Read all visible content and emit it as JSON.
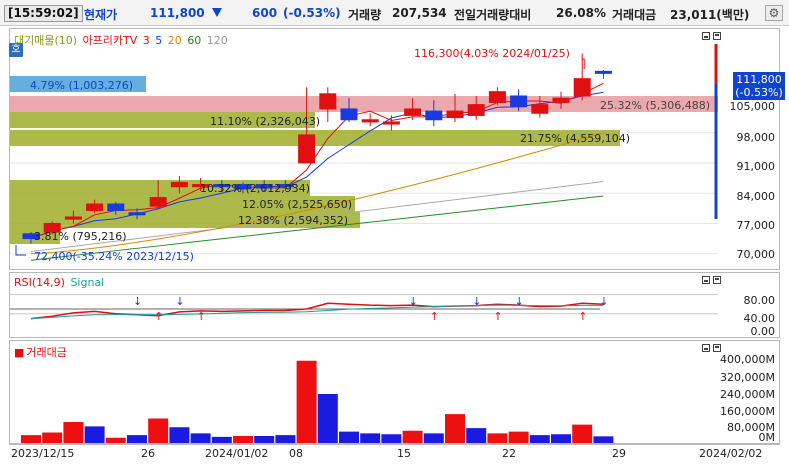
{
  "header": {
    "time": "[15:59:02]",
    "current_price_label": "현재가",
    "current_price": "111,800",
    "change": "600",
    "change_pct": "(-0.53%)",
    "volume_label": "거래량",
    "volume": "207,534",
    "volume_ratio_label": "전일거래량대비",
    "volume_ratio": "26.08%",
    "trade_value_label": "거래대금",
    "trade_value": "23,011(백만)",
    "settings_icon": "settings-icon"
  },
  "price_panel": {
    "ho_button": "호",
    "legend": [
      {
        "text": "대기매물(10)",
        "color": "#8a9a1a"
      },
      {
        "text": "아프리카TV",
        "color": "#e01010"
      },
      {
        "text": "3",
        "color": "#e01010"
      },
      {
        "text": "5",
        "color": "#1a3ae0"
      },
      {
        "text": "20",
        "color": "#d68a00"
      },
      {
        "text": "60",
        "color": "#1a8a1a"
      },
      {
        "text": "120",
        "color": "#999999"
      }
    ],
    "y_ticks": [
      "105,000",
      "98,000",
      "91,000",
      "84,000",
      "77,000",
      "70,000"
    ],
    "last_price": "111,800",
    "last_change": "(-0.53%)",
    "annotations": {
      "high": "116,300(4.03% 2024/01/25)",
      "low": "72,400(-35.24% 2023/12/15)"
    },
    "overhang_labels": [
      "4.79% (1,003,276)",
      "25.32% (5,306,488)",
      "11.10% (2,326,043)",
      "21.75% (4,559,104)",
      "10.32% (2,612,934)",
      "12.05% (2,525,650)",
      "12.38% (2,594,352)",
      "3.81% (795,216)"
    ]
  },
  "rsi_panel": {
    "legend": [
      {
        "text": "RSI(14,9)",
        "color": "#e01010"
      },
      {
        "text": "Signal",
        "color": "#1aa0a0"
      }
    ],
    "y_ticks": [
      "80.00",
      "40.00",
      "0.00"
    ]
  },
  "volume_panel": {
    "legend": "거래대금",
    "y_ticks": [
      "400,000M",
      "320,000M",
      "240,000M",
      "160,000M",
      "80,000M",
      "0M"
    ]
  },
  "x_axis": {
    "labels": [
      "2023/12/15",
      "26",
      "2024/01/02",
      "08",
      "15",
      "22",
      "29",
      "2024/02/02"
    ]
  },
  "chart_data": {
    "type": "candlestick",
    "x": [
      "12/15",
      "12/18",
      "12/19",
      "12/20",
      "12/21",
      "12/22",
      "12/26",
      "12/27",
      "12/28",
      "01/02",
      "01/03",
      "01/04",
      "01/05",
      "01/08",
      "01/09",
      "01/10",
      "01/11",
      "01/12",
      "01/15",
      "01/16",
      "01/17",
      "01/18",
      "01/19",
      "01/22",
      "01/23",
      "01/24",
      "01/25",
      "01/26"
    ],
    "open": [
      74.6,
      75.0,
      78.0,
      80.0,
      81.5,
      79.5,
      81.0,
      85.5,
      85.5,
      86.0,
      86.0,
      86.0,
      86.0,
      91.0,
      103.5,
      103.5,
      100.5,
      100.0,
      102.0,
      103.0,
      101.5,
      102.0,
      105.0,
      106.5,
      102.5,
      105.0,
      106.5,
      112.2
    ],
    "close": [
      73.5,
      77.0,
      78.5,
      81.5,
      80.0,
      79.0,
      83.0,
      86.5,
      86.0,
      85.5,
      85.0,
      85.2,
      85.5,
      97.5,
      107.0,
      101.0,
      101.0,
      100.5,
      103.5,
      101.0,
      103.0,
      104.5,
      107.5,
      104.0,
      104.5,
      106.0,
      110.5,
      111.8
    ],
    "high": [
      75.0,
      77.5,
      80.0,
      82.5,
      82.0,
      80.5,
      87.0,
      88.0,
      87.5,
      87.0,
      86.5,
      87.0,
      87.0,
      108.5,
      108.5,
      106.0,
      102.5,
      102.0,
      106.0,
      105.5,
      107.0,
      106.5,
      108.5,
      108.0,
      106.5,
      107.5,
      116.3,
      112.5
    ],
    "low": [
      72.4,
      74.5,
      77.0,
      79.5,
      79.0,
      78.0,
      80.5,
      84.0,
      84.5,
      84.5,
      84.0,
      84.5,
      84.5,
      91.0,
      100.5,
      100.5,
      99.5,
      98.5,
      101.0,
      99.5,
      100.5,
      101.0,
      104.5,
      103.0,
      101.5,
      103.5,
      105.5,
      110.5
    ],
    "ma20_end": 98.0,
    "y_unit": "thousand KRW",
    "ylim": [
      66,
      122
    ],
    "rsi": [
      30,
      35,
      42,
      45,
      40,
      38,
      36,
      44,
      46,
      45,
      46,
      47,
      47,
      50,
      62,
      60,
      58,
      57,
      58,
      55,
      56,
      57,
      60,
      58,
      55,
      56,
      62,
      60
    ],
    "trade_value_M": [
      45000,
      60000,
      120000,
      95000,
      30000,
      45000,
      140000,
      90000,
      55000,
      35000,
      40000,
      40000,
      45000,
      470000,
      280000,
      65000,
      55000,
      50000,
      70000,
      55000,
      165000,
      85000,
      55000,
      65000,
      45000,
      50000,
      105000,
      38000
    ],
    "trade_value_up": [
      true,
      true,
      true,
      false,
      true,
      false,
      true,
      false,
      false,
      false,
      true,
      false,
      false,
      true,
      false,
      false,
      false,
      false,
      true,
      false,
      true,
      false,
      true,
      true,
      false,
      false,
      true,
      false
    ]
  }
}
